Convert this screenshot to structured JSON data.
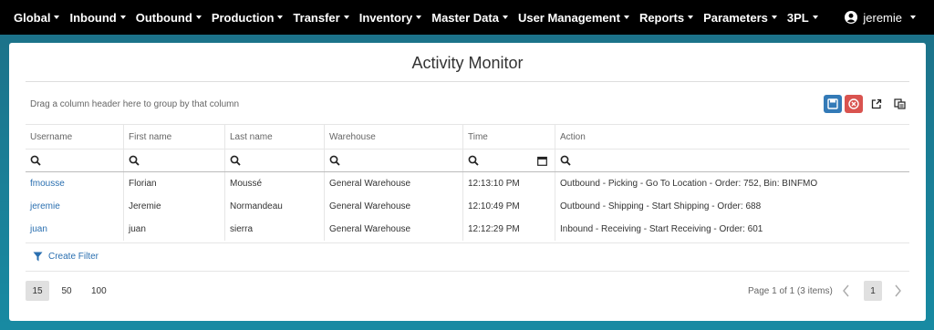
{
  "nav": {
    "items": [
      "Global",
      "Inbound",
      "Outbound",
      "Production",
      "Transfer",
      "Inventory",
      "Master Data",
      "User Management",
      "Reports",
      "Parameters",
      "3PL"
    ],
    "user": "jeremie"
  },
  "page": {
    "title": "Activity Monitor",
    "group_hint": "Drag a column header here to group by that column"
  },
  "toolbar": {
    "save_icon": "save-icon",
    "cancel_icon": "cancel-icon",
    "export_icon": "export-icon",
    "columns_icon": "columns-icon",
    "save_color": "#337ab7",
    "cancel_color": "#d9534f"
  },
  "grid": {
    "columns": [
      "Username",
      "First name",
      "Last name",
      "Warehouse",
      "Time",
      "Action"
    ],
    "rows": [
      [
        "fmousse",
        "Florian",
        "Moussé",
        "General Warehouse",
        "12:13:10 PM",
        "Outbound - Picking - Go To Location - Order: 752, Bin: BINFMO"
      ],
      [
        "jeremie",
        "Jeremie",
        "Normandeau",
        "General Warehouse",
        "12:10:49 PM",
        "Outbound - Shipping - Start Shipping - Order: 688"
      ],
      [
        "juan",
        "juan",
        "sierra",
        "General Warehouse",
        "12:12:29 PM",
        "Inbound - Receiving - Start Receiving - Order: 601"
      ]
    ]
  },
  "filter": {
    "create_label": "Create Filter"
  },
  "pager": {
    "sizes": [
      "15",
      "50",
      "100"
    ],
    "info": "Page 1 of 1 (3 items)",
    "current_page": "1"
  }
}
